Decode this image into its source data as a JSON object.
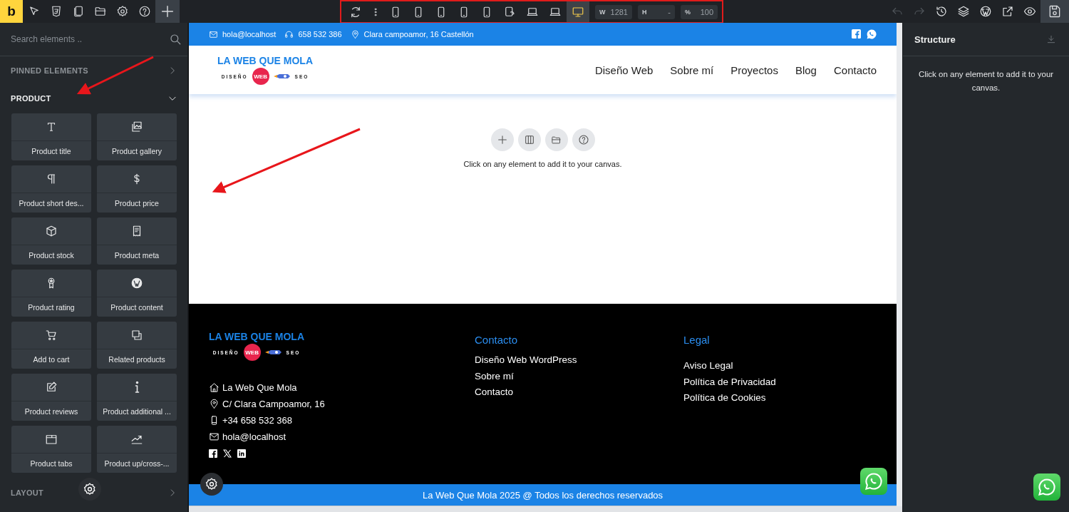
{
  "topbar": {
    "logo": "b",
    "right_tools": [
      {
        "disabled": true
      },
      {
        "disabled": true
      },
      {
        "disabled": false
      },
      {
        "disabled": false
      },
      {
        "disabled": false
      },
      {
        "disabled": false
      },
      {
        "disabled": false
      }
    ]
  },
  "device_toolbar": {
    "devices": [
      {
        "kind": "phone",
        "selected": false
      },
      {
        "kind": "phone",
        "selected": false
      },
      {
        "kind": "phone",
        "selected": false
      },
      {
        "kind": "phone",
        "selected": false
      },
      {
        "kind": "phone",
        "selected": false
      },
      {
        "kind": "tablet",
        "selected": false
      },
      {
        "kind": "laptop",
        "selected": false
      },
      {
        "kind": "laptop",
        "selected": false
      },
      {
        "kind": "desktop",
        "selected": true
      }
    ],
    "fields": [
      {
        "label": "W",
        "value": "1281"
      },
      {
        "label": "H",
        "value": "-"
      },
      {
        "label": "%",
        "value": "100"
      }
    ]
  },
  "sidebar": {
    "search": {
      "placeholder": "Search elements .."
    },
    "sections": [
      {
        "title": "PINNED ELEMENTS",
        "expanded": false
      },
      {
        "title": "PRODUCT",
        "expanded": true,
        "items": [
          {
            "label": "Product title"
          },
          {
            "label": "Product gallery"
          },
          {
            "label": "Product short des..."
          },
          {
            "label": "Product price"
          },
          {
            "label": "Product stock"
          },
          {
            "label": "Product meta"
          },
          {
            "label": "Product rating"
          },
          {
            "label": "Product content"
          },
          {
            "label": "Add to cart"
          },
          {
            "label": "Related products"
          },
          {
            "label": "Product reviews"
          },
          {
            "label": "Product additional ..."
          },
          {
            "label": "Product tabs"
          },
          {
            "label": "Product up/cross-..."
          }
        ]
      },
      {
        "title": "LAYOUT",
        "expanded": false
      }
    ]
  },
  "canvas": {
    "contact_bar": {
      "email": "hola@localhost",
      "phone": "658 532 386",
      "address": "Clara campoamor, 16 Castellón"
    },
    "logo": {
      "title": "LA WEB QUE MOLA",
      "left": "DISEÑO",
      "badge": "WEB",
      "right": "SEO"
    },
    "nav": [
      "Diseño Web",
      "Sobre mí",
      "Proyectos",
      "Blog",
      "Contacto"
    ],
    "empty_message": "Click on any element to add it to your canvas.",
    "footer": {
      "logo": {
        "title": "LA WEB QUE MOLA",
        "left": "DISEÑO",
        "badge": "WEB",
        "right": "SEO"
      },
      "contact_lines": [
        "La Web Que Mola",
        "C/ Clara Campoamor, 16",
        "+34 658 532 368",
        "hola@localhost"
      ],
      "columns": [
        {
          "heading": "Contacto",
          "links": [
            "Diseño Web WordPress",
            "Sobre mí",
            "Contacto"
          ]
        },
        {
          "heading": "Legal",
          "links": [
            "Aviso Legal",
            "Política de Privacidad",
            "Política de Cookies"
          ]
        }
      ],
      "copyright": "La Web Que Mola 2025 @ Todos los derechos reservados"
    }
  },
  "structure": {
    "title": "Structure",
    "message": "Click on any element to add it to your canvas."
  }
}
